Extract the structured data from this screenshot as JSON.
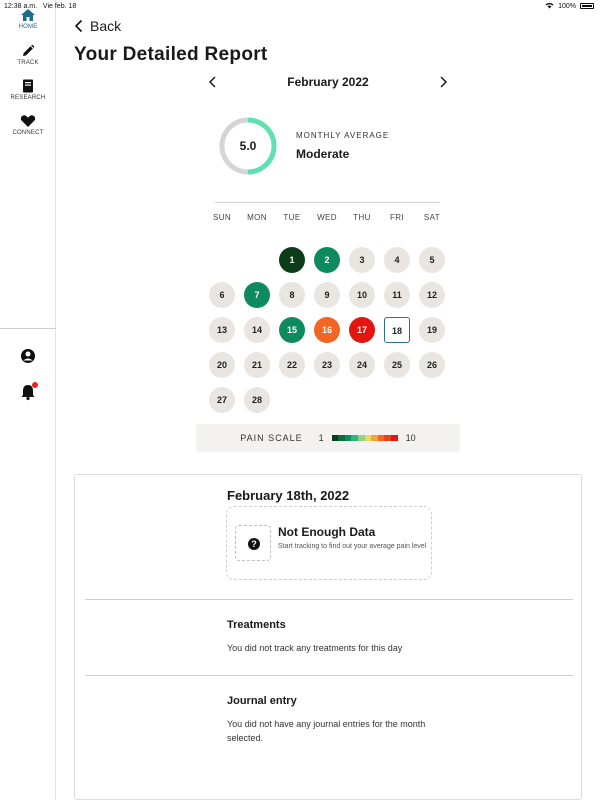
{
  "status_bar": {
    "time": "12:38 a.m.",
    "date": "Vie feb. 18",
    "battery": "100%"
  },
  "sidebar": {
    "items": [
      {
        "label": "HOME",
        "icon": "home-icon"
      },
      {
        "label": "TRACK",
        "icon": "pencil-icon"
      },
      {
        "label": "RESEARCH",
        "icon": "book-icon"
      },
      {
        "label": "CONNECT",
        "icon": "heart-icon"
      }
    ],
    "profile_icon": "profile-icon",
    "notification_icon": "bell-icon"
  },
  "header": {
    "back_label": "Back",
    "title": "Your Detailed Report"
  },
  "calendar": {
    "month_label": "February 2022",
    "monthly_average_label": "MONTHLY AVERAGE",
    "monthly_average_value": "5.0",
    "monthly_average_fraction": 0.5,
    "monthly_average_text": "Moderate",
    "weekdays": [
      "SUN",
      "MON",
      "TUE",
      "WED",
      "THU",
      "FRI",
      "SAT"
    ],
    "first_weekday_index": 2,
    "days": [
      {
        "n": "1",
        "color": "#0c3d18"
      },
      {
        "n": "2",
        "color": "#0e8a5f"
      },
      {
        "n": "3"
      },
      {
        "n": "4"
      },
      {
        "n": "5"
      },
      {
        "n": "6"
      },
      {
        "n": "7",
        "color": "#0e8a5f"
      },
      {
        "n": "8"
      },
      {
        "n": "9"
      },
      {
        "n": "10"
      },
      {
        "n": "11"
      },
      {
        "n": "12"
      },
      {
        "n": "13"
      },
      {
        "n": "14"
      },
      {
        "n": "15",
        "color": "#0e8a5f"
      },
      {
        "n": "16",
        "color": "#f26522"
      },
      {
        "n": "17",
        "color": "#e2160f"
      },
      {
        "n": "18",
        "selected": true
      },
      {
        "n": "19"
      },
      {
        "n": "20"
      },
      {
        "n": "21"
      },
      {
        "n": "22"
      },
      {
        "n": "23"
      },
      {
        "n": "24"
      },
      {
        "n": "25"
      },
      {
        "n": "26"
      },
      {
        "n": "27"
      },
      {
        "n": "28"
      }
    ],
    "colors": {
      "ring_fill": "#5fe0b0",
      "ring_track": "#d5d5d5",
      "day_default": "#e9e5e0",
      "selected_border": "#2e6f95"
    }
  },
  "pain_scale": {
    "label": "PAIN SCALE",
    "min": "1",
    "max": "10",
    "colors": [
      "#0c3d18",
      "#0e6b3a",
      "#0e8a5f",
      "#2fb57a",
      "#8fd08a",
      "#f5d45a",
      "#f7a33c",
      "#f26522",
      "#e8411c",
      "#e2160f"
    ]
  },
  "detail": {
    "date_title": "February 18th, 2022",
    "nodata_title": "Not Enough Data",
    "nodata_sub": "Start tracking to find out your average pain level",
    "treatments_title": "Treatments",
    "treatments_text": "You did not track any treatments for this day",
    "journal_title": "Journal entry",
    "journal_text": "You did not have any journal entries for the month selected."
  }
}
